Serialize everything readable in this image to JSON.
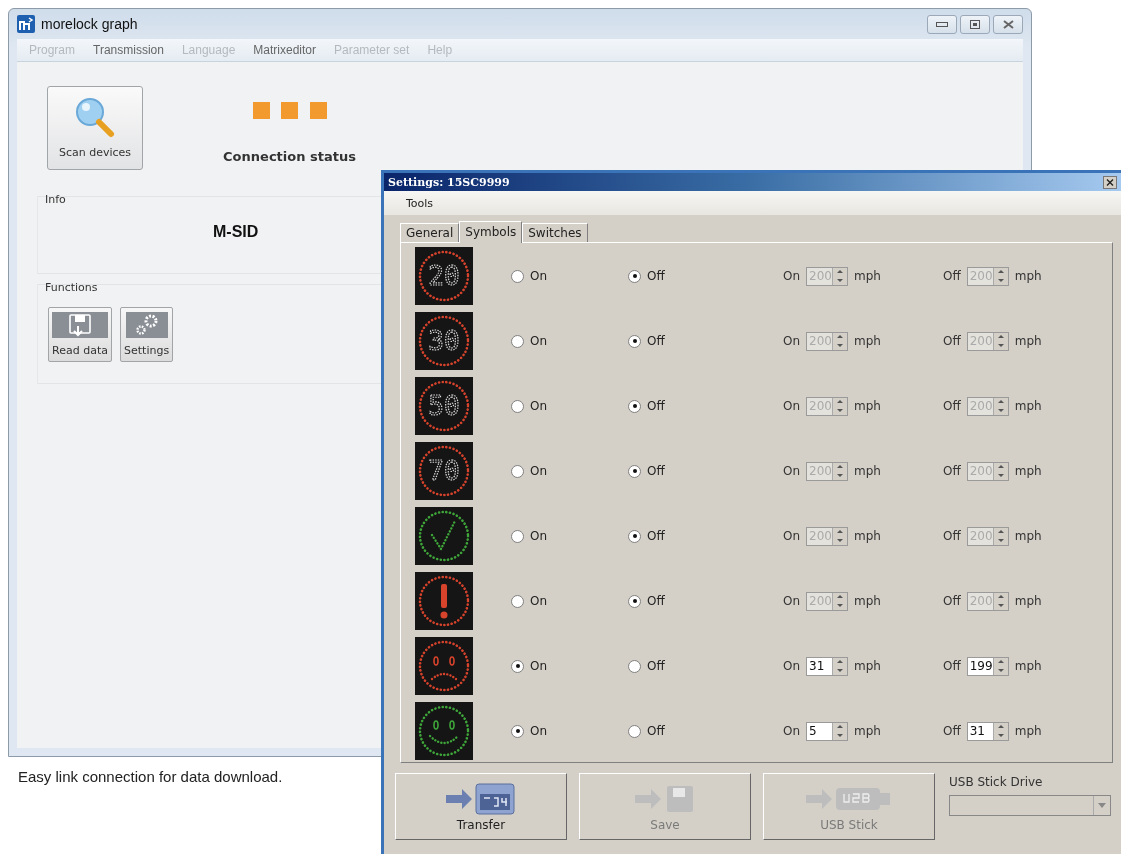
{
  "main_window": {
    "title": "morelock graph",
    "menu": [
      {
        "label": "Program",
        "disabled": true
      },
      {
        "label": "Transmission",
        "disabled": false
      },
      {
        "label": "Language",
        "disabled": true
      },
      {
        "label": "Matrixeditor",
        "disabled": false
      },
      {
        "label": "Parameter set",
        "disabled": true
      },
      {
        "label": "Help",
        "disabled": true
      }
    ],
    "scan_button": "Scan devices",
    "connection_status": "Connection status",
    "info": {
      "title": "Info",
      "device": "M-SID"
    },
    "functions": {
      "title": "Functions",
      "buttons": [
        {
          "label": "Read data",
          "kind": "read"
        },
        {
          "label": "Settings",
          "kind": "settings"
        }
      ]
    }
  },
  "caption": "Easy link connection for data download.",
  "settings_dialog": {
    "title": "Settings: 15SC9999",
    "menu": [
      "Tools"
    ],
    "tabs": [
      {
        "label": "General",
        "selected": false
      },
      {
        "label": "Symbols",
        "selected": true
      },
      {
        "label": "Switches",
        "selected": false
      }
    ],
    "symbols": [
      {
        "kind": "speed",
        "sign_text": "20",
        "on_option": {
          "label": "On",
          "selected": false
        },
        "off_option": {
          "label": "Off",
          "selected": true
        },
        "on_threshold": {
          "label": "On",
          "value": "200",
          "unit": "mph",
          "disabled": true
        },
        "off_threshold": {
          "label": "Off",
          "value": "200",
          "unit": "mph",
          "disabled": true
        }
      },
      {
        "kind": "speed",
        "sign_text": "30",
        "on_option": {
          "label": "On",
          "selected": false
        },
        "off_option": {
          "label": "Off",
          "selected": true
        },
        "on_threshold": {
          "label": "On",
          "value": "200",
          "unit": "mph",
          "disabled": true
        },
        "off_threshold": {
          "label": "Off",
          "value": "200",
          "unit": "mph",
          "disabled": true
        }
      },
      {
        "kind": "speed",
        "sign_text": "50",
        "on_option": {
          "label": "On",
          "selected": false
        },
        "off_option": {
          "label": "Off",
          "selected": true
        },
        "on_threshold": {
          "label": "On",
          "value": "200",
          "unit": "mph",
          "disabled": true
        },
        "off_threshold": {
          "label": "Off",
          "value": "200",
          "unit": "mph",
          "disabled": true
        }
      },
      {
        "kind": "speed",
        "sign_text": "70",
        "on_option": {
          "label": "On",
          "selected": false
        },
        "off_option": {
          "label": "Off",
          "selected": true
        },
        "on_threshold": {
          "label": "On",
          "value": "200",
          "unit": "mph",
          "disabled": true
        },
        "off_threshold": {
          "label": "Off",
          "value": "200",
          "unit": "mph",
          "disabled": true
        }
      },
      {
        "kind": "check",
        "on_option": {
          "label": "On",
          "selected": false
        },
        "off_option": {
          "label": "Off",
          "selected": true
        },
        "on_threshold": {
          "label": "On",
          "value": "200",
          "unit": "mph",
          "disabled": true
        },
        "off_threshold": {
          "label": "Off",
          "value": "200",
          "unit": "mph",
          "disabled": true
        }
      },
      {
        "kind": "warning",
        "on_option": {
          "label": "On",
          "selected": false
        },
        "off_option": {
          "label": "Off",
          "selected": true
        },
        "on_threshold": {
          "label": "On",
          "value": "200",
          "unit": "mph",
          "disabled": true
        },
        "off_threshold": {
          "label": "Off",
          "value": "200",
          "unit": "mph",
          "disabled": true
        }
      },
      {
        "kind": "sad",
        "on_option": {
          "label": "On",
          "selected": true
        },
        "off_option": {
          "label": "Off",
          "selected": false
        },
        "on_threshold": {
          "label": "On",
          "value": "31",
          "unit": "mph",
          "disabled": false
        },
        "off_threshold": {
          "label": "Off",
          "value": "199",
          "unit": "mph",
          "disabled": false
        }
      },
      {
        "kind": "smile",
        "on_option": {
          "label": "On",
          "selected": true
        },
        "off_option": {
          "label": "Off",
          "selected": false
        },
        "on_threshold": {
          "label": "On",
          "value": "5",
          "unit": "mph",
          "disabled": false
        },
        "off_threshold": {
          "label": "Off",
          "value": "31",
          "unit": "mph",
          "disabled": false
        }
      }
    ],
    "buttons": [
      {
        "label": "Transfer",
        "kind": "transfer",
        "disabled": false
      },
      {
        "label": "Save",
        "kind": "save",
        "disabled": true
      },
      {
        "label": "USB Stick",
        "kind": "usb",
        "disabled": true
      }
    ],
    "usb_drive": {
      "label": "USB Stick Drive",
      "disabled": true
    }
  }
}
